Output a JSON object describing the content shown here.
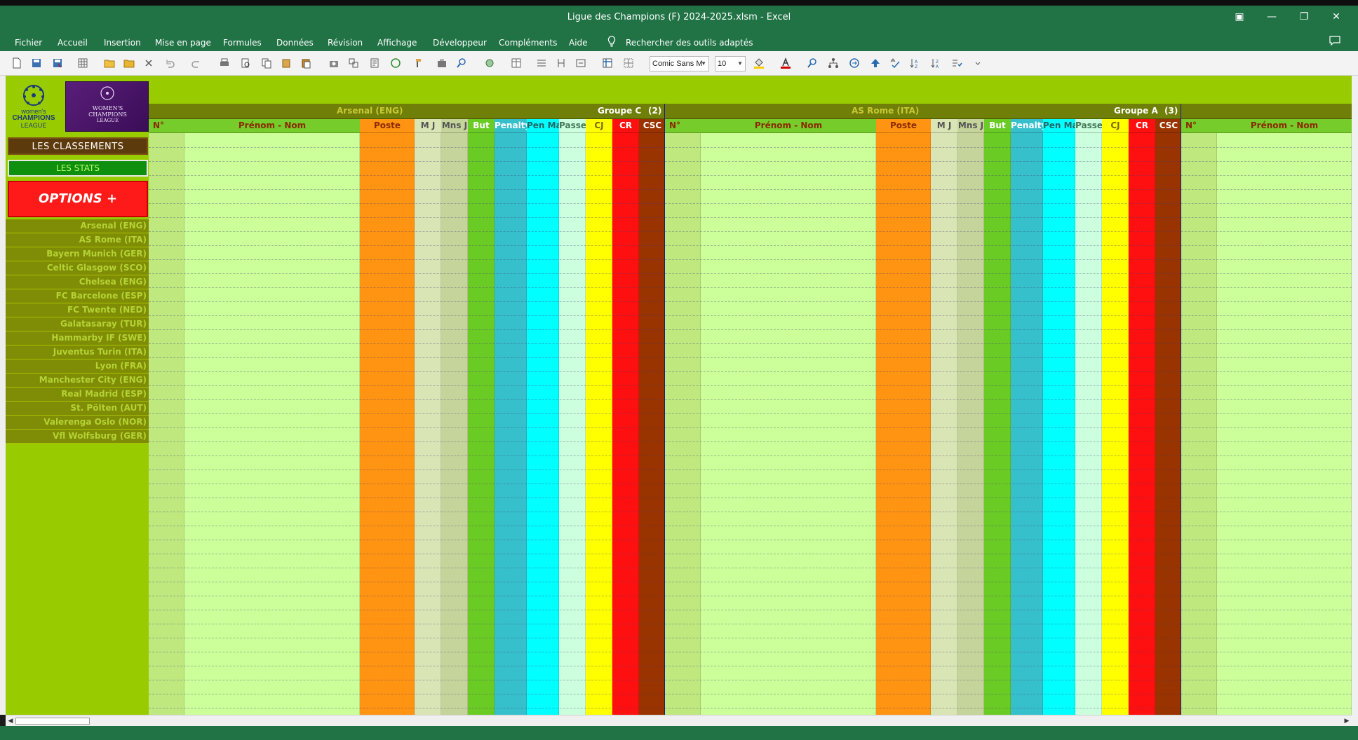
{
  "window": {
    "title": "Ligue des Champions (F) 2024-2025.xlsm  -  Excel",
    "controls": [
      "▣",
      "—",
      "❐",
      "✕"
    ]
  },
  "menu": [
    "Fichier",
    "Accueil",
    "Insertion",
    "Mise en page",
    "Formules",
    "Données",
    "Révision",
    "Affichage",
    "Développeur",
    "Compléments",
    "Aide"
  ],
  "search": {
    "label": "Rechercher des outils adaptés"
  },
  "toolbar": {
    "font_name": "Comic Sans M",
    "font_size": "10",
    "accent_colors": {
      "font_color": "#d40000",
      "fill_color": "#ffcc00"
    }
  },
  "sidebar": {
    "logo_left": {
      "line1": "women's",
      "line2": "CHAMPIONS",
      "line3": "LEAGUE"
    },
    "logo_right": {
      "line1": "WOMEN'S",
      "line2": "CHAMPIONS",
      "line3": "LEAGUE"
    },
    "btn_classements": "LES CLASSEMENTS",
    "btn_stats": "LES STATS",
    "btn_options": "OPTIONS +",
    "teams": [
      "Arsenal (ENG)",
      "AS Rome (ITA)",
      "Bayern Munich (GER)",
      "Celtic Glasgow (SCO)",
      "Chelsea (ENG)",
      "FC Barcelone (ESP)",
      "FC Twente (NED)",
      "Galatasaray (TUR)",
      "Hammarby IF (SWE)",
      "Juventus Turin (ITA)",
      "Lyon (FRA)",
      "Manchester City (ENG)",
      "Real Madrid (ESP)",
      "St. Pölten (AUT)",
      "Valerenga Oslo (NOR)",
      "Vfl Wolfsburg (GER)"
    ]
  },
  "blocks": [
    {
      "team": "Arsenal (ENG)",
      "group": "Groupe C",
      "num": "(2)"
    },
    {
      "team": "AS Rome (ITA)",
      "group": "Groupe A",
      "num": "(3)"
    }
  ],
  "columns": [
    {
      "label": "N°",
      "bg": "#bfe87f",
      "head_bg": "#76cc2a",
      "head_color": "#8a2a00"
    },
    {
      "label": "Prénom - Nom",
      "bg": "#ccff99",
      "head_bg": "#76cc2a",
      "head_color": "#8a2a00"
    },
    {
      "label": "Poste",
      "bg": "#ff9312",
      "head_bg": "#ff9312",
      "head_color": "#8a2a00"
    },
    {
      "label": "M J",
      "bg": "#d9e5b5",
      "head_bg": "#d9e5b5",
      "head_color": "#555555"
    },
    {
      "label": "Mns J",
      "bg": "#c5d49b",
      "head_bg": "#c5d49b",
      "head_color": "#555555"
    },
    {
      "label": "But",
      "bg": "#6acb25",
      "head_bg": "#6acb25",
      "head_color": "#ffffff"
    },
    {
      "label": "Penalty",
      "bg": "#36c0cc",
      "head_bg": "#36c0cc",
      "head_color": "#ffffff"
    },
    {
      "label": "Pen Mar",
      "bg": "#00ffff",
      "head_bg": "#00ffff",
      "head_color": "#226666"
    },
    {
      "label": "Passe",
      "bg": "#ccffdd",
      "head_bg": "#ccffdd",
      "head_color": "#447755"
    },
    {
      "label": "CJ",
      "bg": "#ffff00",
      "head_bg": "#ffff00",
      "head_color": "#7a6a00"
    },
    {
      "label": "CR",
      "bg": "#ff1010",
      "head_bg": "#ff1010",
      "head_color": "#ffffff"
    },
    {
      "label": "CSC",
      "bg": "#993300",
      "head_bg": "#993300",
      "head_color": "#ffffff"
    }
  ]
}
